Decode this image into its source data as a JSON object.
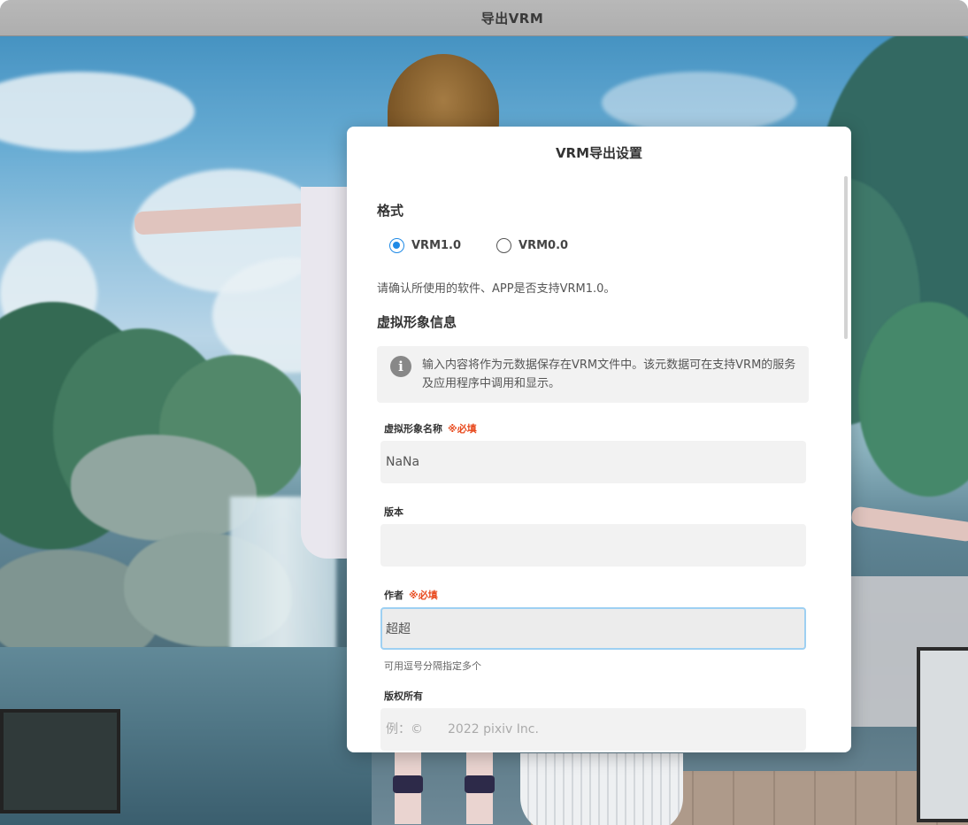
{
  "window": {
    "title": "导出VRM"
  },
  "dialog": {
    "title": "VRM导出设置",
    "format": {
      "heading": "格式",
      "options": [
        {
          "label": "VRM1.0",
          "selected": true
        },
        {
          "label": "VRM0.0",
          "selected": false
        }
      ],
      "note": "请确认所使用的软件、APP是否支持VRM1.0。"
    },
    "avatar_info": {
      "heading": "虚拟形象信息",
      "info_icon": "info-icon",
      "info_text": "输入内容将作为元数据保存在VRM文件中。该元数据可在支持VRM的服务及应用程序中调用和显示。",
      "fields": {
        "name": {
          "label": "虚拟形象名称",
          "required_mark": "※必填",
          "value": "NaNa"
        },
        "version": {
          "label": "版本",
          "value": ""
        },
        "author": {
          "label": "作者",
          "required_mark": "※必填",
          "value": "超超",
          "hint": "可用逗号分隔指定多个"
        },
        "copyright": {
          "label": "版权所有",
          "value": "",
          "placeholder": "例：©　　2022 pixiv Inc."
        }
      }
    }
  },
  "colors": {
    "accent": "#1f8ae6",
    "required": "#e8491d",
    "focus_border": "#9ed0f2"
  }
}
